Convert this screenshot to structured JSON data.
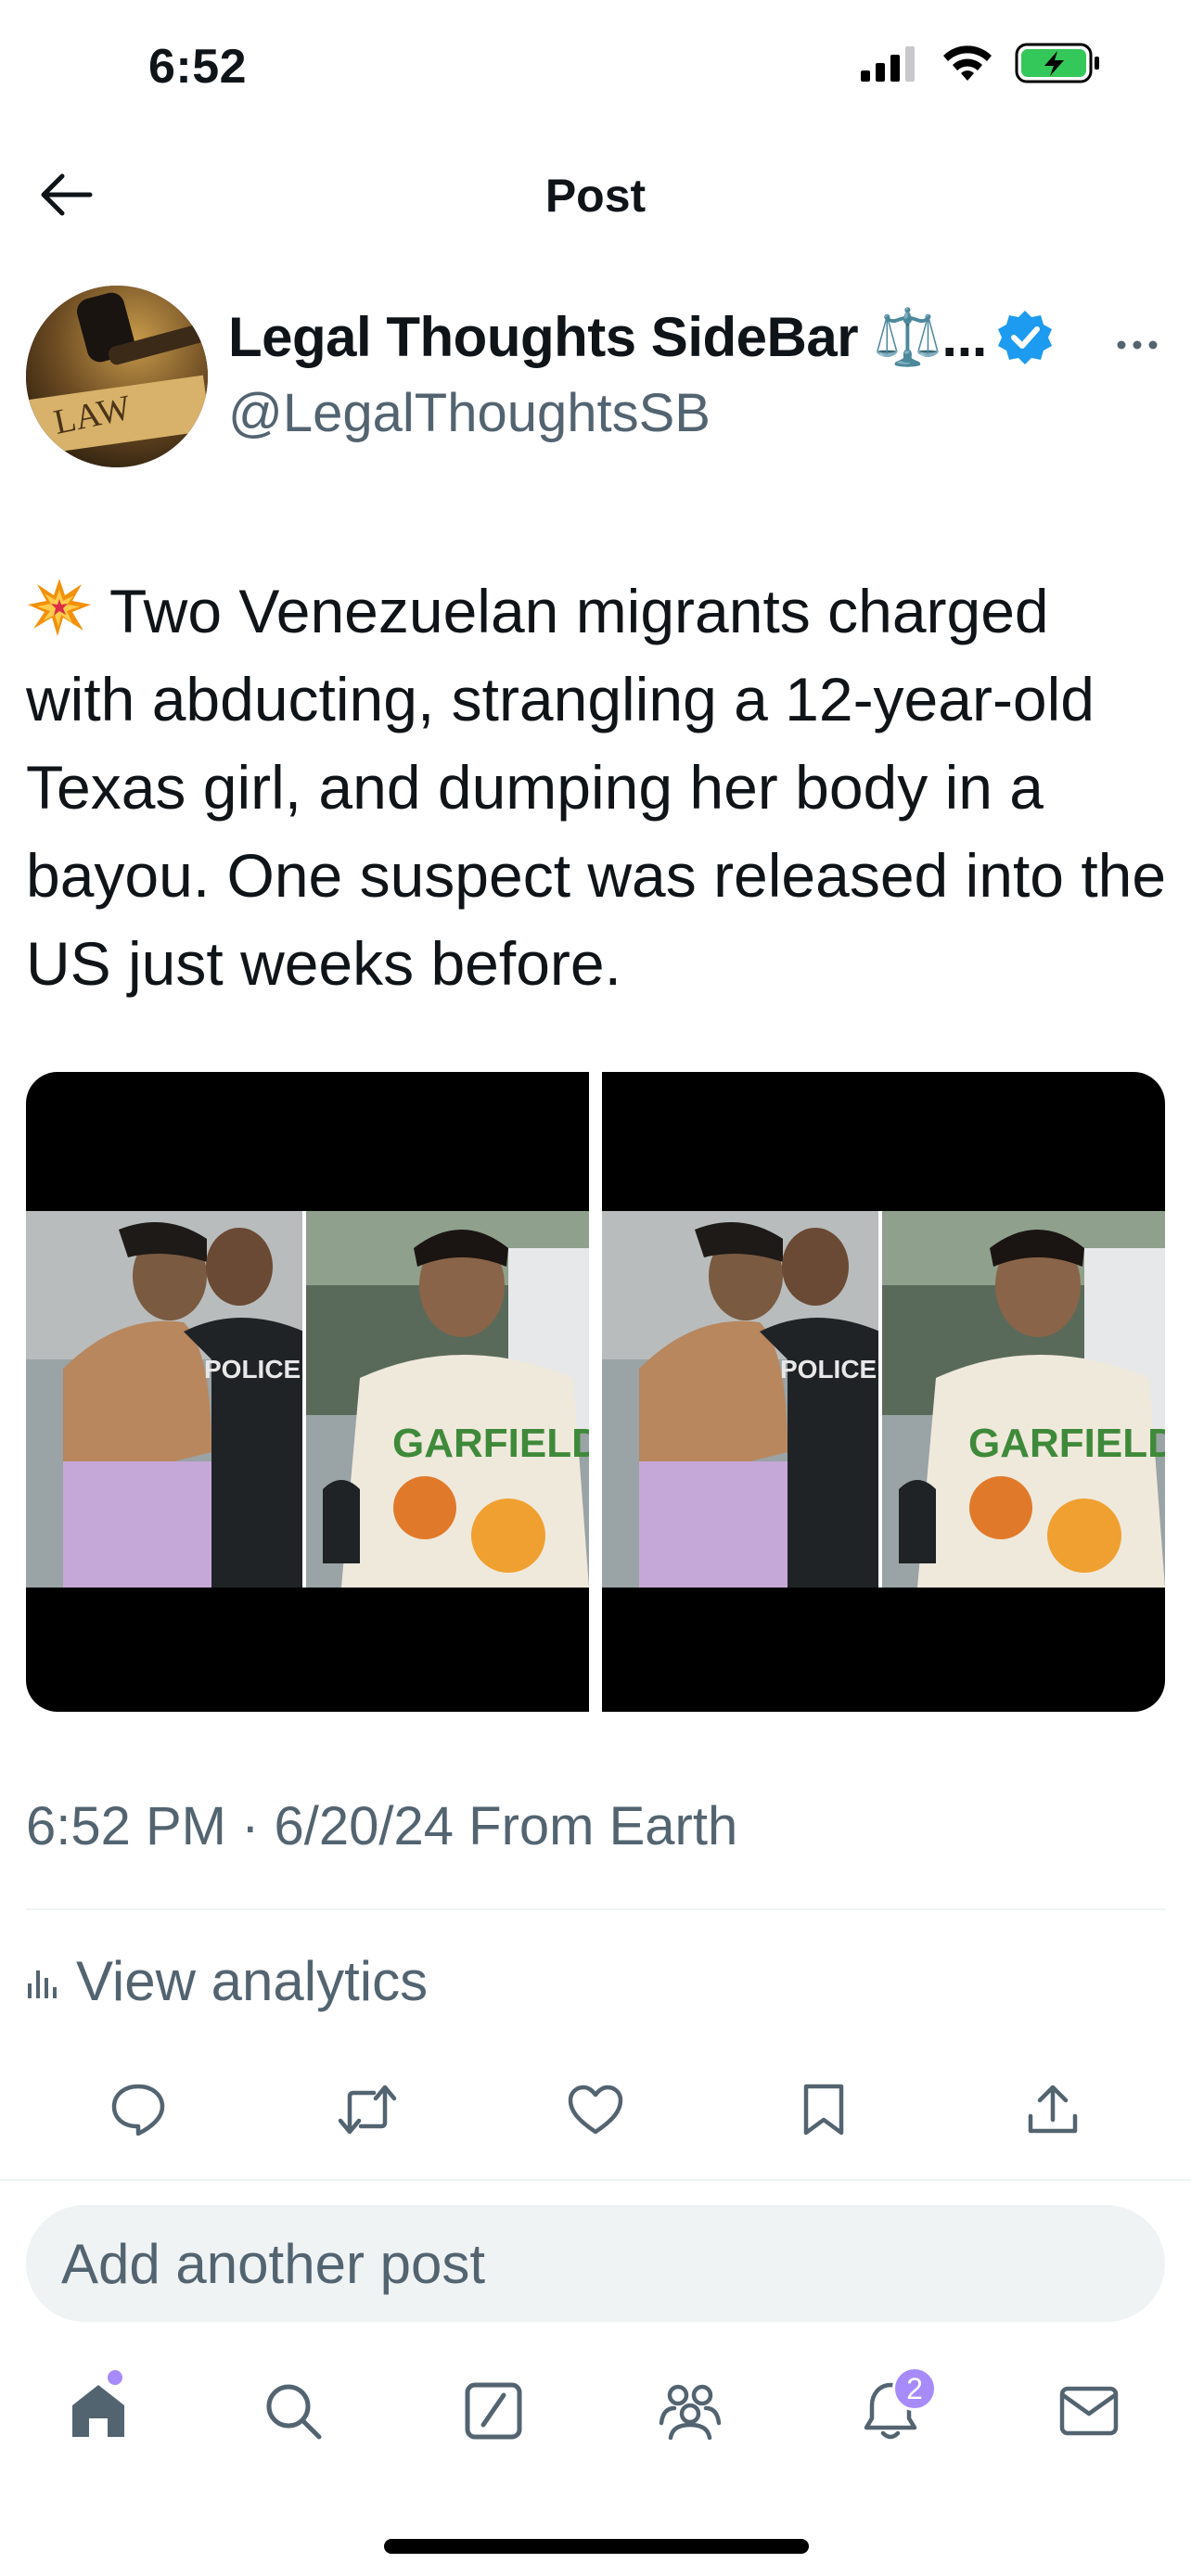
{
  "status_bar": {
    "time": "6:52"
  },
  "header": {
    "title": "Post"
  },
  "author": {
    "display_name": "Legal Thoughts SideBar ⚖️...",
    "handle": "@LegalThoughtsSB",
    "avatar_text": "LAW",
    "verified_color": "#1d9bf0"
  },
  "post": {
    "emoji": "💥",
    "text": "Two Venezuelan migrants charged with abducting, strangling a 12-year-old Texas girl, and dumping her body in a bayou. One suspect was released into the US just weeks before.",
    "timestamp": "6:52 PM · 6/20/24 From Earth"
  },
  "analytics": {
    "label": "View analytics"
  },
  "media": {
    "caption_texts": [
      "POLICE",
      "POLICE"
    ],
    "shirt_text": "GARFIELD"
  },
  "actions": [
    "reply-icon",
    "repost-icon",
    "like-icon",
    "bookmark-icon",
    "share-icon"
  ],
  "reply": {
    "placeholder": "Add another post"
  },
  "tabbar": {
    "items": [
      "home-icon",
      "search-icon",
      "grok-icon",
      "communities-icon",
      "notifications-icon",
      "messages-icon"
    ],
    "notification_count": "2"
  },
  "colors": {
    "text": "#0f1419",
    "secondary": "#536471",
    "accent": "#1d9bf0",
    "badge": "#a78bfa",
    "battery": "#34c759"
  }
}
